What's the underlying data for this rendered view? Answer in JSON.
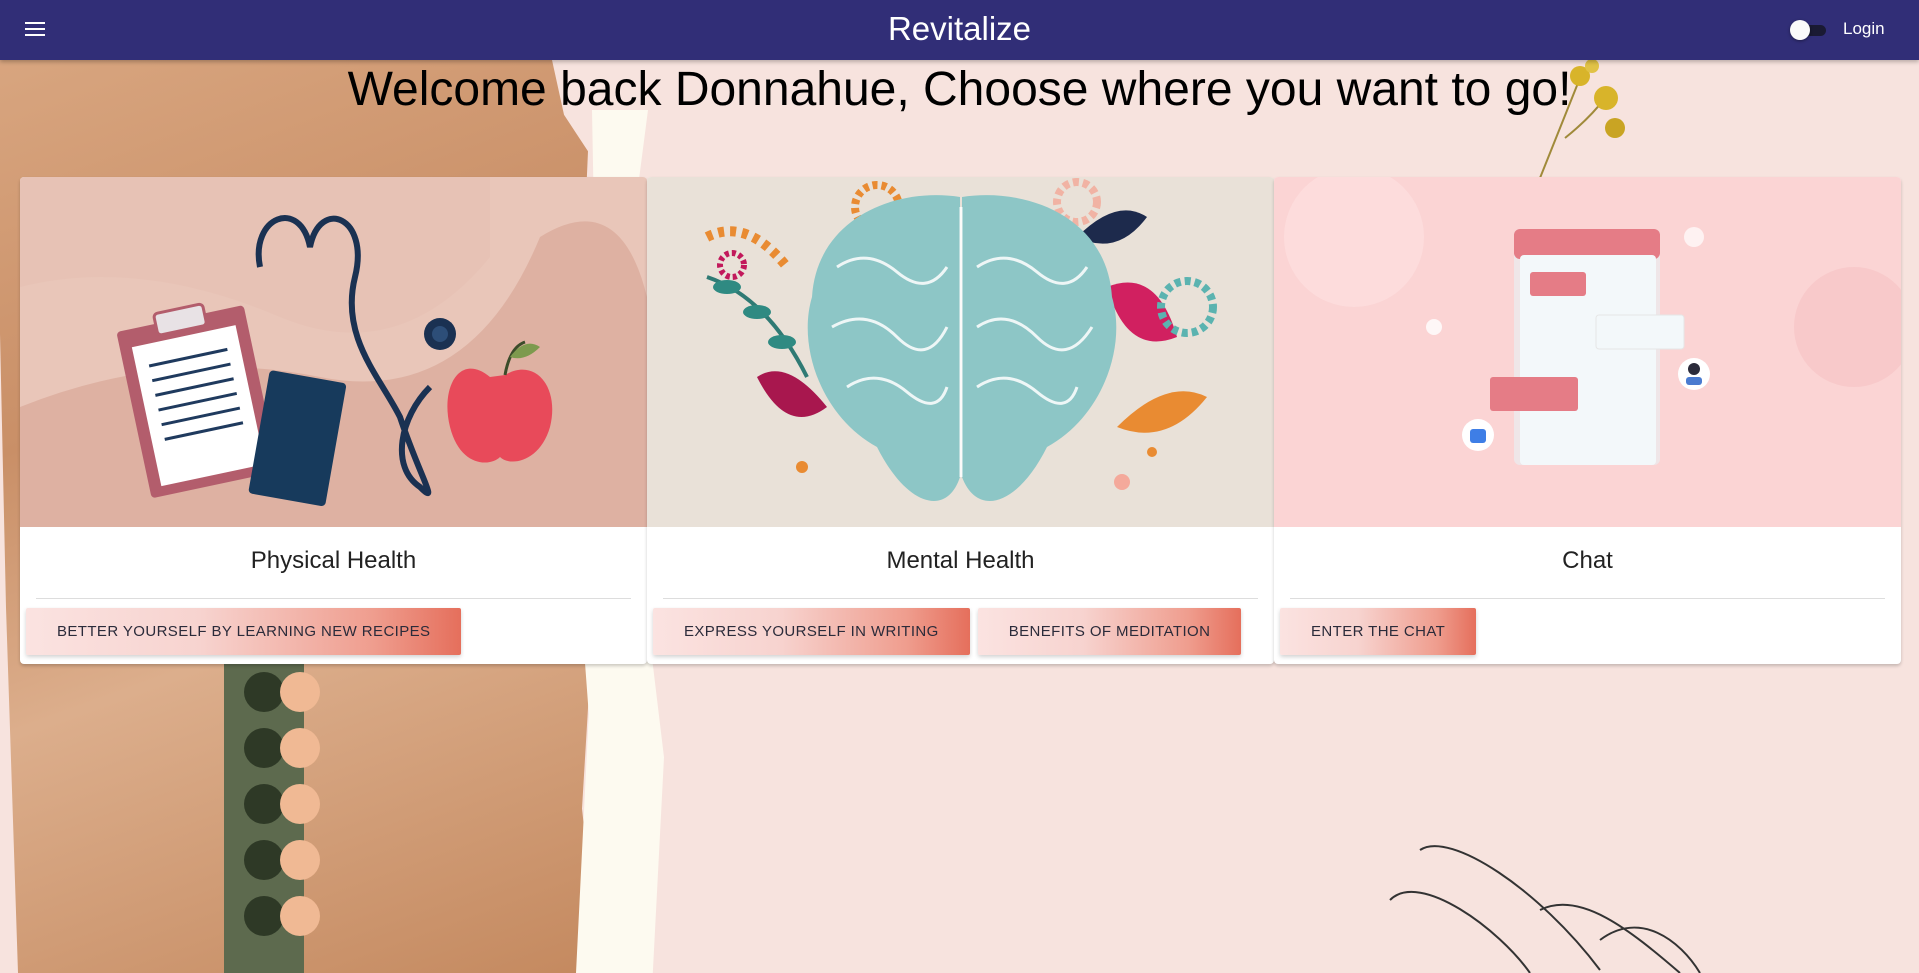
{
  "app": {
    "title": "Revitalize"
  },
  "header": {
    "login_label": "Login"
  },
  "headline": "Welcome back Donnahue, Choose where you want to go!",
  "cards": [
    {
      "title": "Physical Health",
      "actions": [
        "BETTER YOURSELF BY LEARNING NEW RECIPES"
      ]
    },
    {
      "title": "Mental Health",
      "actions": [
        "EXPRESS YOURSELF IN WRITING",
        "BENEFITS OF MEDITATION"
      ]
    },
    {
      "title": "Chat",
      "actions": [
        "ENTER THE CHAT"
      ]
    }
  ],
  "colors": {
    "topbar": "#312e77",
    "page_background": "#f7e3de",
    "button_gradient_end": "#e56f5c"
  },
  "icons": [
    "menu-icon",
    "theme-toggle"
  ]
}
